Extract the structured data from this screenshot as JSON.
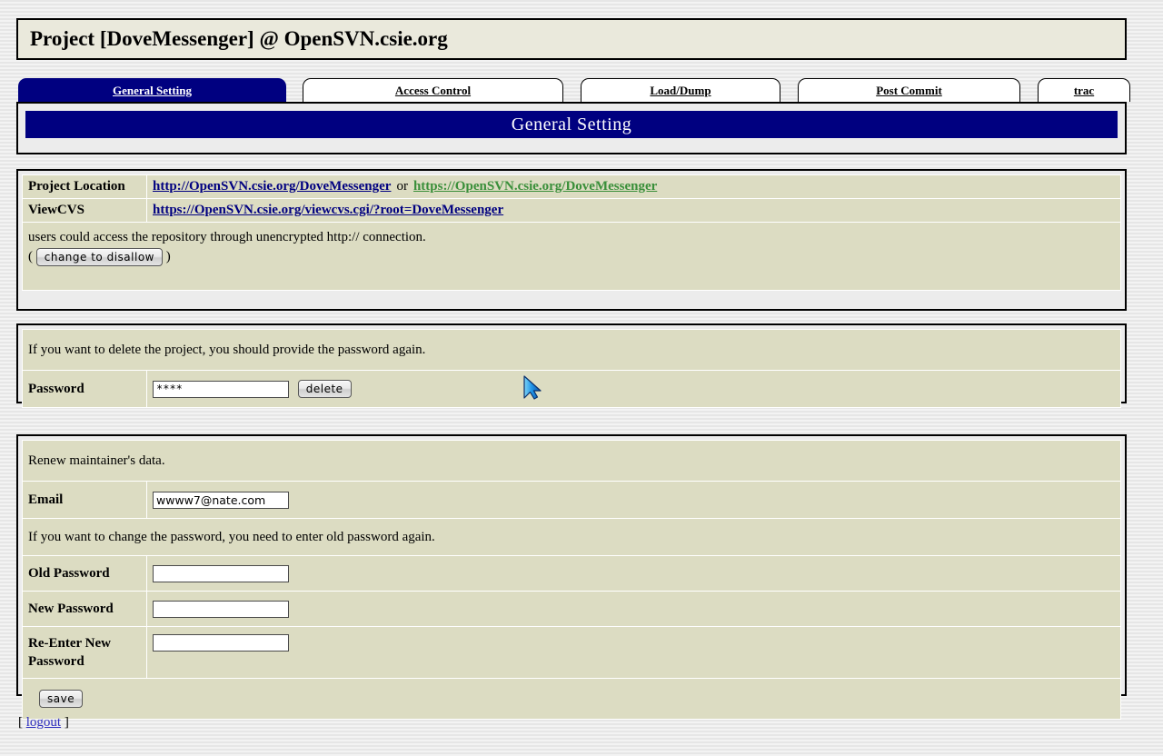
{
  "header": {
    "title": "Project [DoveMessenger] @ OpenSVN.csie.org"
  },
  "tabs": [
    {
      "label": "General Setting",
      "active": true
    },
    {
      "label": "Access Control",
      "active": false
    },
    {
      "label": "Load/Dump",
      "active": false
    },
    {
      "label": "Post Commit",
      "active": false
    },
    {
      "label": "trac",
      "active": false
    }
  ],
  "banner": {
    "title": "General Setting"
  },
  "project_info": {
    "location_label": "Project Location",
    "location_http": "http://OpenSVN.csie.org/DoveMessenger",
    "location_or": "or",
    "location_https": "https://OpenSVN.csie.org/DoveMessenger",
    "viewcvs_label": "ViewCVS",
    "viewcvs_url": "https://OpenSVN.csie.org/viewcvs.cgi/?root=DoveMessenger",
    "access_note": "users could access the repository through unencrypted http:// connection.",
    "paren_open": "(",
    "change_button": "change to disallow",
    "paren_close": ")"
  },
  "delete_section": {
    "note": "If you want to delete the project, you should provide the password again.",
    "password_label": "Password",
    "password_value": "****",
    "delete_button": "delete"
  },
  "maintainer_section": {
    "note": "Renew maintainer's data.",
    "email_label": "Email",
    "email_value": "wwww7@nate.com",
    "change_pw_note": "If you want to change the password, you need to enter old password again.",
    "old_password_label": "Old Password",
    "old_password_value": "",
    "new_password_label": "New Password",
    "new_password_value": "",
    "reenter_password_label": "Re-Enter New Password",
    "reenter_password_value": "",
    "save_button": "save"
  },
  "footer": {
    "bracket_open": "[",
    "logout_label": "logout",
    "bracket_close": "]"
  },
  "colors": {
    "navy": "#000080",
    "beige": "#dcdcc2",
    "ivory": "#fdfdf0",
    "link_blue": "#000080",
    "link_green": "#3a8f3a"
  }
}
